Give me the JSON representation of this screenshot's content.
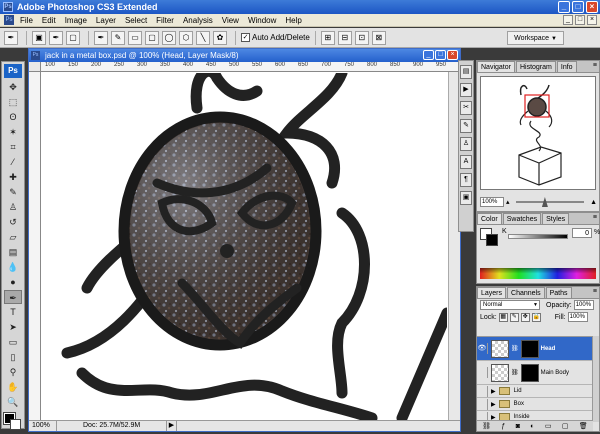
{
  "app": {
    "title": "Adobe Photoshop CS3 Extended",
    "icon_text": "Ps",
    "window_buttons": [
      "_",
      "□",
      "×"
    ]
  },
  "menu": {
    "items": [
      "File",
      "Edit",
      "Image",
      "Layer",
      "Select",
      "Filter",
      "Analysis",
      "View",
      "Window",
      "Help"
    ],
    "doc_buttons": [
      "_",
      "□",
      "×"
    ]
  },
  "options_bar": {
    "auto_add_delete_label": "Auto Add/Delete",
    "auto_add_delete_checked": true,
    "workspace_label": "Workspace",
    "icons": [
      "pen-tool-icon",
      "shape-layers-icon",
      "paths-icon",
      "fill-pixels-icon",
      "rectangle-icon",
      "rounded-rectangle-icon",
      "ellipse-icon",
      "polygon-icon",
      "line-icon",
      "custom-shape-icon"
    ]
  },
  "tools": {
    "logo": "Ps",
    "items": [
      {
        "name": "move-tool",
        "glyph": "✥"
      },
      {
        "name": "marquee-tool",
        "glyph": "⬚"
      },
      {
        "name": "lasso-tool",
        "glyph": "ʘ"
      },
      {
        "name": "magic-wand-tool",
        "glyph": "✶"
      },
      {
        "name": "crop-tool",
        "glyph": "⌗"
      },
      {
        "name": "slice-tool",
        "glyph": "⁄"
      },
      {
        "name": "healing-brush-tool",
        "glyph": "✚"
      },
      {
        "name": "brush-tool",
        "glyph": "✎"
      },
      {
        "name": "clone-stamp-tool",
        "glyph": "♙"
      },
      {
        "name": "history-brush-tool",
        "glyph": "↺"
      },
      {
        "name": "eraser-tool",
        "glyph": "▱"
      },
      {
        "name": "gradient-tool",
        "glyph": "▤"
      },
      {
        "name": "blur-tool",
        "glyph": "💧"
      },
      {
        "name": "dodge-tool",
        "glyph": "●"
      },
      {
        "name": "pen-tool",
        "glyph": "✒"
      },
      {
        "name": "type-tool",
        "glyph": "T"
      },
      {
        "name": "path-selection-tool",
        "glyph": "➤"
      },
      {
        "name": "shape-tool",
        "glyph": "▭"
      },
      {
        "name": "notes-tool",
        "glyph": "▯"
      },
      {
        "name": "eyedropper-tool",
        "glyph": "⚲"
      },
      {
        "name": "hand-tool",
        "glyph": "✋"
      },
      {
        "name": "zoom-tool",
        "glyph": "🔍"
      }
    ],
    "active_index": 14
  },
  "document": {
    "title": "jack in a metal box.psd @ 100% (Head, Layer Mask/8)",
    "ruler_labels": [
      "100",
      "150",
      "200",
      "250",
      "300",
      "350",
      "400",
      "450",
      "500",
      "550",
      "600",
      "650",
      "700",
      "750",
      "800",
      "850",
      "900",
      "950"
    ],
    "zoom": "100%",
    "doc_size": "Doc: 25.7M/52.9M"
  },
  "navigator": {
    "tabs": [
      "Navigator",
      "Histogram",
      "Info"
    ],
    "zoom": "100%",
    "zoom_level_fraction": 0.33
  },
  "color_panel": {
    "tabs": [
      "Color",
      "Swatches",
      "Styles"
    ],
    "channel_label": "K",
    "value": "0",
    "unit": "%"
  },
  "layers_panel": {
    "tabs": [
      "Layers",
      "Channels",
      "Paths"
    ],
    "blend_mode": "Normal",
    "opacity_label": "Opacity:",
    "opacity_value": "100%",
    "lock_label": "Lock:",
    "fill_label": "Fill:",
    "fill_value": "100%",
    "layers": [
      {
        "name": "Head",
        "type": "layer",
        "selected": true,
        "visible": true
      },
      {
        "name": "Main Body",
        "type": "layer",
        "selected": false,
        "visible": false
      },
      {
        "name": "Lid",
        "type": "group",
        "selected": false,
        "visible": false
      },
      {
        "name": "Box",
        "type": "group",
        "selected": false,
        "visible": false
      },
      {
        "name": "Inside",
        "type": "group",
        "selected": false,
        "visible": false
      }
    ],
    "footer_icons": [
      "link-icon",
      "fx-icon",
      "mask-icon",
      "adjustment-icon",
      "group-icon",
      "new-layer-icon",
      "trash-icon"
    ]
  },
  "colors": {
    "titlebar": "#1c56c4",
    "selection": "#3168c8",
    "panel_bg": "#e3e3e3",
    "stroke": "#222222"
  }
}
